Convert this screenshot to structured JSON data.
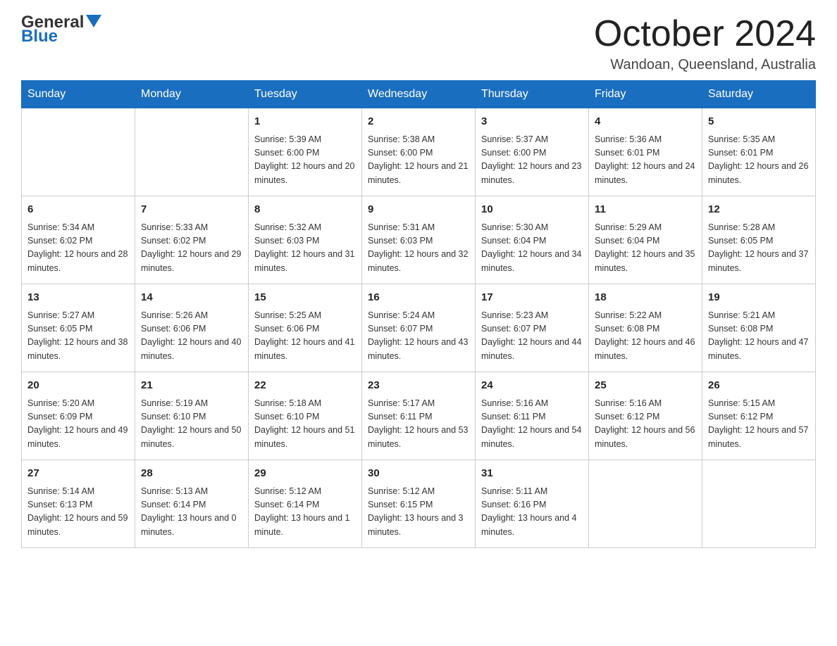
{
  "header": {
    "logo_general": "General",
    "logo_blue": "Blue",
    "month_title": "October 2024",
    "location": "Wandoan, Queensland, Australia"
  },
  "days_of_week": [
    "Sunday",
    "Monday",
    "Tuesday",
    "Wednesday",
    "Thursday",
    "Friday",
    "Saturday"
  ],
  "weeks": [
    [
      {
        "day": "",
        "sunrise": "",
        "sunset": "",
        "daylight": ""
      },
      {
        "day": "",
        "sunrise": "",
        "sunset": "",
        "daylight": ""
      },
      {
        "day": "1",
        "sunrise": "Sunrise: 5:39 AM",
        "sunset": "Sunset: 6:00 PM",
        "daylight": "Daylight: 12 hours and 20 minutes."
      },
      {
        "day": "2",
        "sunrise": "Sunrise: 5:38 AM",
        "sunset": "Sunset: 6:00 PM",
        "daylight": "Daylight: 12 hours and 21 minutes."
      },
      {
        "day": "3",
        "sunrise": "Sunrise: 5:37 AM",
        "sunset": "Sunset: 6:00 PM",
        "daylight": "Daylight: 12 hours and 23 minutes."
      },
      {
        "day": "4",
        "sunrise": "Sunrise: 5:36 AM",
        "sunset": "Sunset: 6:01 PM",
        "daylight": "Daylight: 12 hours and 24 minutes."
      },
      {
        "day": "5",
        "sunrise": "Sunrise: 5:35 AM",
        "sunset": "Sunset: 6:01 PM",
        "daylight": "Daylight: 12 hours and 26 minutes."
      }
    ],
    [
      {
        "day": "6",
        "sunrise": "Sunrise: 5:34 AM",
        "sunset": "Sunset: 6:02 PM",
        "daylight": "Daylight: 12 hours and 28 minutes."
      },
      {
        "day": "7",
        "sunrise": "Sunrise: 5:33 AM",
        "sunset": "Sunset: 6:02 PM",
        "daylight": "Daylight: 12 hours and 29 minutes."
      },
      {
        "day": "8",
        "sunrise": "Sunrise: 5:32 AM",
        "sunset": "Sunset: 6:03 PM",
        "daylight": "Daylight: 12 hours and 31 minutes."
      },
      {
        "day": "9",
        "sunrise": "Sunrise: 5:31 AM",
        "sunset": "Sunset: 6:03 PM",
        "daylight": "Daylight: 12 hours and 32 minutes."
      },
      {
        "day": "10",
        "sunrise": "Sunrise: 5:30 AM",
        "sunset": "Sunset: 6:04 PM",
        "daylight": "Daylight: 12 hours and 34 minutes."
      },
      {
        "day": "11",
        "sunrise": "Sunrise: 5:29 AM",
        "sunset": "Sunset: 6:04 PM",
        "daylight": "Daylight: 12 hours and 35 minutes."
      },
      {
        "day": "12",
        "sunrise": "Sunrise: 5:28 AM",
        "sunset": "Sunset: 6:05 PM",
        "daylight": "Daylight: 12 hours and 37 minutes."
      }
    ],
    [
      {
        "day": "13",
        "sunrise": "Sunrise: 5:27 AM",
        "sunset": "Sunset: 6:05 PM",
        "daylight": "Daylight: 12 hours and 38 minutes."
      },
      {
        "day": "14",
        "sunrise": "Sunrise: 5:26 AM",
        "sunset": "Sunset: 6:06 PM",
        "daylight": "Daylight: 12 hours and 40 minutes."
      },
      {
        "day": "15",
        "sunrise": "Sunrise: 5:25 AM",
        "sunset": "Sunset: 6:06 PM",
        "daylight": "Daylight: 12 hours and 41 minutes."
      },
      {
        "day": "16",
        "sunrise": "Sunrise: 5:24 AM",
        "sunset": "Sunset: 6:07 PM",
        "daylight": "Daylight: 12 hours and 43 minutes."
      },
      {
        "day": "17",
        "sunrise": "Sunrise: 5:23 AM",
        "sunset": "Sunset: 6:07 PM",
        "daylight": "Daylight: 12 hours and 44 minutes."
      },
      {
        "day": "18",
        "sunrise": "Sunrise: 5:22 AM",
        "sunset": "Sunset: 6:08 PM",
        "daylight": "Daylight: 12 hours and 46 minutes."
      },
      {
        "day": "19",
        "sunrise": "Sunrise: 5:21 AM",
        "sunset": "Sunset: 6:08 PM",
        "daylight": "Daylight: 12 hours and 47 minutes."
      }
    ],
    [
      {
        "day": "20",
        "sunrise": "Sunrise: 5:20 AM",
        "sunset": "Sunset: 6:09 PM",
        "daylight": "Daylight: 12 hours and 49 minutes."
      },
      {
        "day": "21",
        "sunrise": "Sunrise: 5:19 AM",
        "sunset": "Sunset: 6:10 PM",
        "daylight": "Daylight: 12 hours and 50 minutes."
      },
      {
        "day": "22",
        "sunrise": "Sunrise: 5:18 AM",
        "sunset": "Sunset: 6:10 PM",
        "daylight": "Daylight: 12 hours and 51 minutes."
      },
      {
        "day": "23",
        "sunrise": "Sunrise: 5:17 AM",
        "sunset": "Sunset: 6:11 PM",
        "daylight": "Daylight: 12 hours and 53 minutes."
      },
      {
        "day": "24",
        "sunrise": "Sunrise: 5:16 AM",
        "sunset": "Sunset: 6:11 PM",
        "daylight": "Daylight: 12 hours and 54 minutes."
      },
      {
        "day": "25",
        "sunrise": "Sunrise: 5:16 AM",
        "sunset": "Sunset: 6:12 PM",
        "daylight": "Daylight: 12 hours and 56 minutes."
      },
      {
        "day": "26",
        "sunrise": "Sunrise: 5:15 AM",
        "sunset": "Sunset: 6:12 PM",
        "daylight": "Daylight: 12 hours and 57 minutes."
      }
    ],
    [
      {
        "day": "27",
        "sunrise": "Sunrise: 5:14 AM",
        "sunset": "Sunset: 6:13 PM",
        "daylight": "Daylight: 12 hours and 59 minutes."
      },
      {
        "day": "28",
        "sunrise": "Sunrise: 5:13 AM",
        "sunset": "Sunset: 6:14 PM",
        "daylight": "Daylight: 13 hours and 0 minutes."
      },
      {
        "day": "29",
        "sunrise": "Sunrise: 5:12 AM",
        "sunset": "Sunset: 6:14 PM",
        "daylight": "Daylight: 13 hours and 1 minute."
      },
      {
        "day": "30",
        "sunrise": "Sunrise: 5:12 AM",
        "sunset": "Sunset: 6:15 PM",
        "daylight": "Daylight: 13 hours and 3 minutes."
      },
      {
        "day": "31",
        "sunrise": "Sunrise: 5:11 AM",
        "sunset": "Sunset: 6:16 PM",
        "daylight": "Daylight: 13 hours and 4 minutes."
      },
      {
        "day": "",
        "sunrise": "",
        "sunset": "",
        "daylight": ""
      },
      {
        "day": "",
        "sunrise": "",
        "sunset": "",
        "daylight": ""
      }
    ]
  ]
}
